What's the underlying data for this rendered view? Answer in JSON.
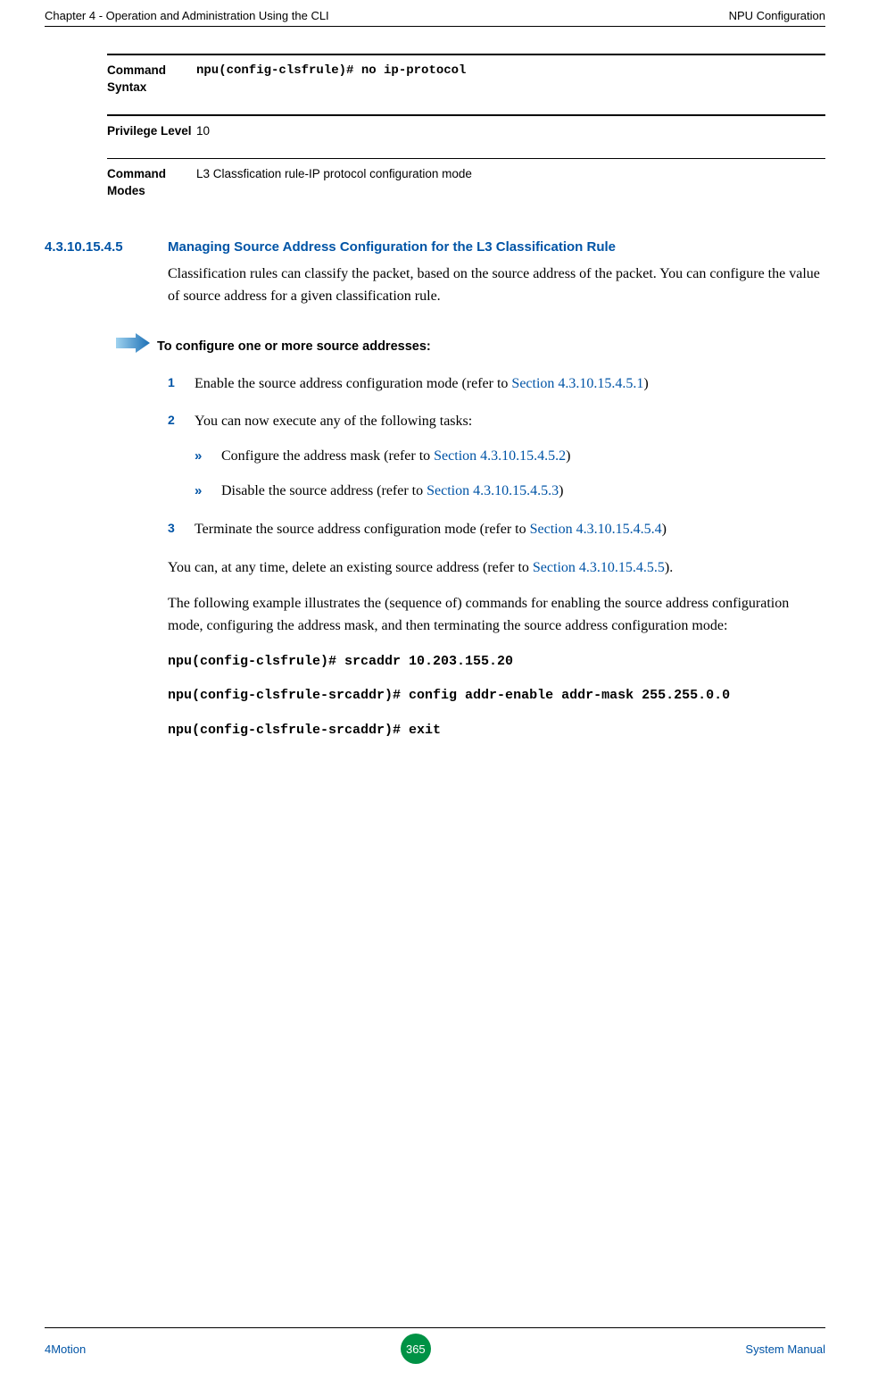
{
  "header": {
    "left": "Chapter 4 - Operation and Administration Using the CLI",
    "right": "NPU Configuration"
  },
  "kv": {
    "syntax_key": "Command Syntax",
    "syntax_val": "npu(config-clsfrule)# no ip-protocol",
    "priv_key": "Privilege Level",
    "priv_val": "10",
    "modes_key": "Command Modes",
    "modes_val": "L3 Classfication rule-IP protocol configuration mode"
  },
  "section": {
    "num": "4.3.10.15.4.5",
    "title": "Managing Source Address Configuration for the L3 Classification Rule",
    "intro": "Classification rules can classify the packet, based on the source address of the packet. You can configure the value of source address for a given classification rule."
  },
  "proc_title": "To configure one or more source addresses:",
  "steps": {
    "s1_pre": "Enable the source address configuration mode (refer to ",
    "s1_link": "Section 4.3.10.15.4.5.1",
    "s1_post": ")",
    "s2": "You can now execute any of the following tasks:",
    "s2a_pre": "Configure the address mask (refer to ",
    "s2a_link": "Section 4.3.10.15.4.5.2",
    "s2a_post": ")",
    "s2b_pre": "Disable the source address (refer to ",
    "s2b_link": "Section 4.3.10.15.4.5.3",
    "s2b_post": ")",
    "s3_pre": "Terminate the source address configuration mode (refer to ",
    "s3_link": "Section 4.3.10.15.4.5.4",
    "s3_post": ")"
  },
  "after": {
    "p1_pre": "You can, at any time, delete an existing source address (refer to ",
    "p1_link": "Section 4.3.10.15.4.5.5",
    "p1_post": ").",
    "p2": "The following example illustrates the (sequence of) commands for enabling the source address configuration mode, configuring the address mask, and then terminating the source address configuration mode:"
  },
  "cmds": {
    "c1": "npu(config-clsfrule)# srcaddr 10.203.155.20",
    "c2": "npu(config-clsfrule-srcaddr)# config addr-enable addr-mask 255.255.0.0",
    "c3": "npu(config-clsfrule-srcaddr)# exit"
  },
  "footer": {
    "left": "4Motion",
    "page": "365",
    "right": "System Manual"
  },
  "nums": {
    "n1": "1",
    "n2": "2",
    "n3": "3"
  },
  "bul": "»"
}
